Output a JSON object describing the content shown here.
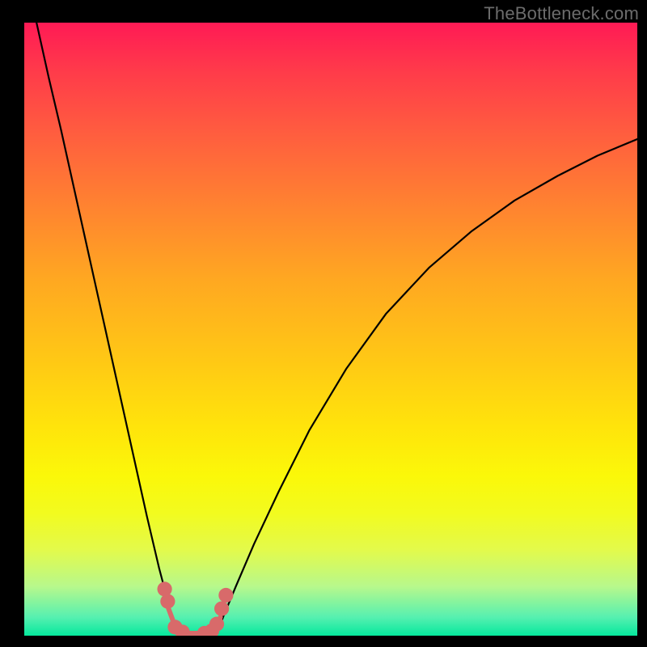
{
  "watermark": "TheBottleneck.com",
  "chart_data": {
    "type": "line",
    "title": "",
    "xlabel": "",
    "ylabel": "",
    "xlim": [
      0,
      100
    ],
    "ylim": [
      0,
      100
    ],
    "grid": false,
    "legend": false,
    "series": [
      {
        "name": "left-branch",
        "stroke": "#000000",
        "x": [
          2,
          4,
          6,
          8,
          10,
          12,
          14,
          16,
          18,
          20,
          22,
          23.8,
          24.6
        ],
        "y": [
          100,
          91,
          82.5,
          73.5,
          64.5,
          55.5,
          46.5,
          37.5,
          28.5,
          19.5,
          11,
          4.2,
          0.5
        ]
      },
      {
        "name": "right-branch",
        "stroke": "#000000",
        "x": [
          31.5,
          32.5,
          34.5,
          37.5,
          41.5,
          46.5,
          52.5,
          59.0,
          66.0,
          73.0,
          80.0,
          87.0,
          93.5,
          100.0
        ],
        "y": [
          0.5,
          3.2,
          8.0,
          15.0,
          23.5,
          33.5,
          43.5,
          52.5,
          60.0,
          66.0,
          71.0,
          75.0,
          78.3,
          81.0
        ]
      },
      {
        "name": "bottom-string",
        "stroke": "#d86a6a",
        "x": [
          23.5,
          24.5,
          25.5,
          27.0,
          29.0,
          31.0,
          32.0
        ],
        "y": [
          4.5,
          1.8,
          0.7,
          0.4,
          0.4,
          1.0,
          3.0
        ]
      }
    ],
    "markers": [
      {
        "name": "bead",
        "x": 22.9,
        "y": 7.6,
        "r": 1.2,
        "fill": "#d86a6a"
      },
      {
        "name": "bead",
        "x": 23.4,
        "y": 5.6,
        "r": 1.2,
        "fill": "#d86a6a"
      },
      {
        "name": "bead",
        "x": 24.6,
        "y": 1.4,
        "r": 1.2,
        "fill": "#d86a6a"
      },
      {
        "name": "bead",
        "x": 25.8,
        "y": 0.6,
        "r": 1.2,
        "fill": "#d86a6a"
      },
      {
        "name": "bead",
        "x": 29.4,
        "y": 0.4,
        "r": 1.2,
        "fill": "#d86a6a"
      },
      {
        "name": "bead",
        "x": 30.6,
        "y": 0.8,
        "r": 1.2,
        "fill": "#d86a6a"
      },
      {
        "name": "bead",
        "x": 31.4,
        "y": 1.9,
        "r": 1.2,
        "fill": "#d86a6a"
      },
      {
        "name": "bead",
        "x": 32.2,
        "y": 4.4,
        "r": 1.2,
        "fill": "#d86a6a"
      },
      {
        "name": "bead",
        "x": 32.9,
        "y": 6.6,
        "r": 1.2,
        "fill": "#d86a6a"
      }
    ]
  }
}
